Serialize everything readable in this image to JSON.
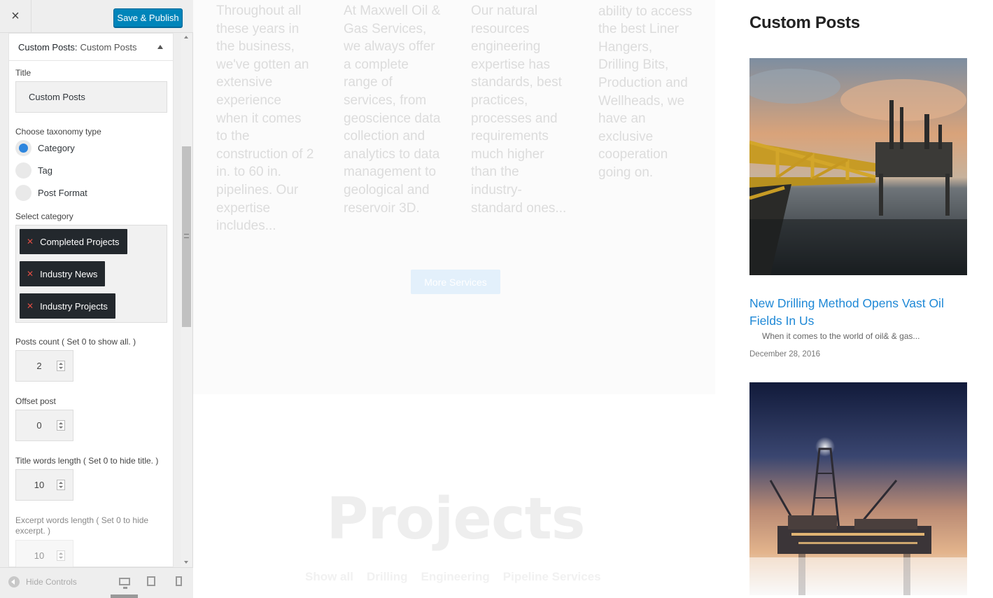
{
  "customizer": {
    "close_label": "×",
    "publish_label": "Save & Publish",
    "widget_title": "Custom Posts:",
    "widget_subtitle": "Custom Posts",
    "title_label": "Title",
    "title_value": "Custom Posts",
    "taxonomy_label": "Choose taxonomy type",
    "taxonomy_options": [
      "Category",
      "Tag",
      "Post Format"
    ],
    "taxonomy_selected": "Category",
    "category_label": "Select category",
    "categories": [
      "Completed Projects",
      "Industry News",
      "Industry Projects"
    ],
    "posts_count_label": "Posts count ( Set 0 to show all. )",
    "posts_count": "2",
    "offset_label": "Offset post",
    "offset": "0",
    "title_words_label": "Title words length ( Set 0 to hide title. )",
    "title_words": "10",
    "excerpt_words_label": "Excerpt words length ( Set 0 to hide excerpt. )",
    "excerpt_words": "10",
    "hide_controls_label": "Hide Controls",
    "accent_color": "#0085ba"
  },
  "preview": {
    "services": [
      "Throughout all these years in the business, we've gotten an extensive experience when it comes to the construction of 2 in. to 60 in. pipelines. Our expertise includes...",
      "At Maxwell Oil & Gas Services, we always offer a complete range of services, from geoscience data collection and analytics to data management to geological and reservoir 3D.",
      "Our natural resources engineering expertise has standards, best practices, processes and requirements much higher than the industry-standard ones...",
      "to having the ability to access the best Liner Hangers, Drilling Bits, Production and Wellheads, we have an exclusive cooperation going on."
    ],
    "more_services_label": "More Services",
    "projects_title": "Projects",
    "filters": [
      "Show all",
      "Drilling",
      "Engineering",
      "Pipeline Services"
    ],
    "sidebar_title": "Custom Posts",
    "post1": {
      "title": "New Drilling Method Opens Vast Oil Fields In Us",
      "excerpt": "When it comes to the world of oil& & gas...",
      "date": "December 28, 2016"
    }
  }
}
